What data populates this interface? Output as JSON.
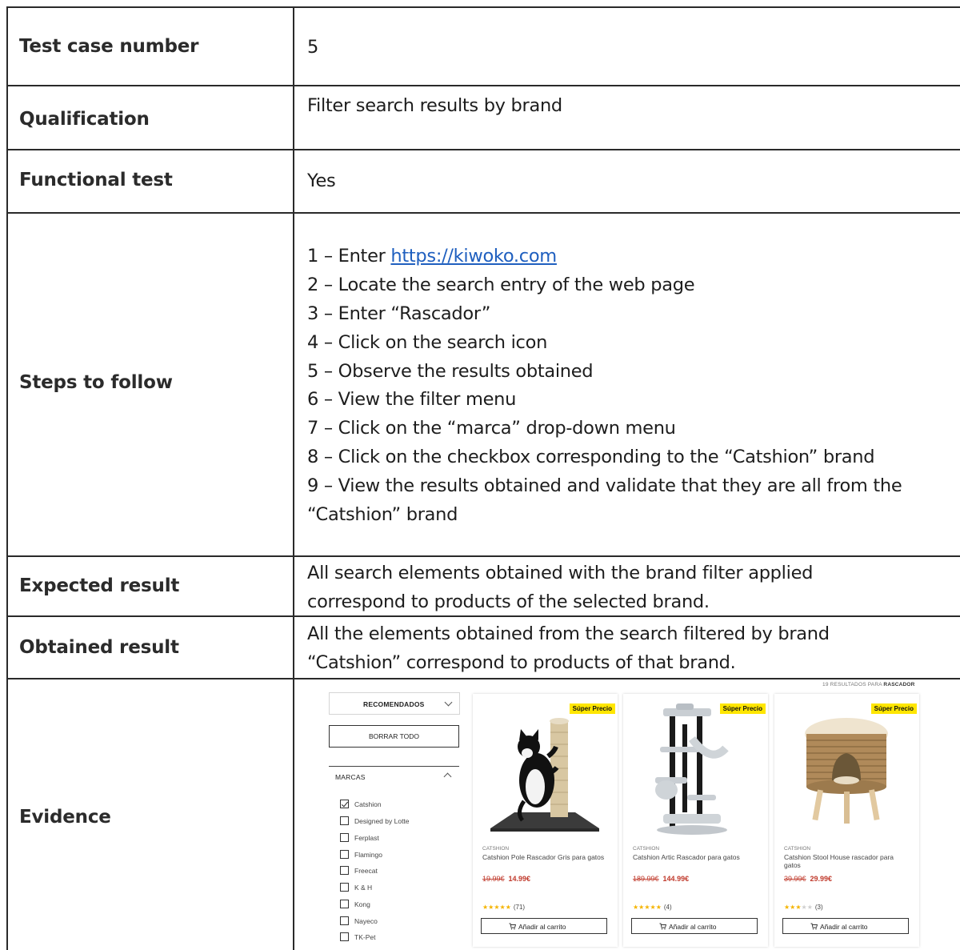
{
  "table": {
    "rows": [
      {
        "label": "Test case number",
        "value": "5"
      },
      {
        "label": "Qualification",
        "value": "Filter search results by brand"
      },
      {
        "label": "Functional test",
        "value": "Yes"
      },
      {
        "label": "Steps to follow"
      },
      {
        "label": "Expected result",
        "lines": [
          "All search elements obtained with the brand filter applied",
          "correspond to products of the selected brand."
        ]
      },
      {
        "label": "Obtained result",
        "lines": [
          "All the elements obtained from the search filtered by brand",
          "“Catshion” correspond to products of that brand."
        ]
      },
      {
        "label": "Evidence"
      }
    ],
    "steps": [
      {
        "prefix": "1 – Enter ",
        "link": "https://kiwoko.com"
      },
      {
        "text": "2 – Locate the search entry of the web page"
      },
      {
        "text": "3 – Enter “Rascador”"
      },
      {
        "text": "4 – Click on the search icon"
      },
      {
        "text": "5 – Observe the results obtained"
      },
      {
        "text": "6 – View the filter menu"
      },
      {
        "text": "7 – Click on the “marca” drop-down menu"
      },
      {
        "text": "8 – Click on the checkbox corresponding to the “Catshion” brand"
      },
      {
        "text": "9 – View the results obtained and validate that they are all from the"
      },
      {
        "text": "“Catshion” brand"
      }
    ]
  },
  "evidence": {
    "results_count": {
      "prefix": "19 RESULTADOS PARA ",
      "term": "RASCADOR"
    },
    "sort_label": "RECOMENDADOS",
    "clear_all": "BORRAR TODO",
    "brands_title": "MARCAS",
    "brands": [
      {
        "name": "Catshion",
        "checked": true
      },
      {
        "name": "Designed by Lotte",
        "checked": false
      },
      {
        "name": "Ferplast",
        "checked": false
      },
      {
        "name": "Flamingo",
        "checked": false
      },
      {
        "name": "Freecat",
        "checked": false
      },
      {
        "name": "K & H",
        "checked": false
      },
      {
        "name": "Kong",
        "checked": false
      },
      {
        "name": "Nayeco",
        "checked": false
      },
      {
        "name": "TK-Pet",
        "checked": false
      }
    ],
    "products": [
      {
        "badge": "Súper Precio",
        "brand": "CATSHION",
        "title": "Catshion Pole Rascador Gris para gatos",
        "old_price": "19.99€",
        "price": "14.99€",
        "stars": 5,
        "reviews": "(71)",
        "cart": "Añadir al carrito",
        "image": "cat-pole-scratcher"
      },
      {
        "badge": "Súper Precio",
        "brand": "CATSHION",
        "title": "Catshion Artic Rascador para gatos",
        "old_price": "189.99€",
        "price": "144.99€",
        "stars": 5,
        "reviews": "(4)",
        "cart": "Añadir al carrito",
        "image": "cat-tree-tower"
      },
      {
        "badge": "Súper Precio",
        "brand": "CATSHION",
        "title": "Catshion Stool House rascador para gatos",
        "old_price": "39.99€",
        "price": "29.99€",
        "stars": 3,
        "reviews": "(3)",
        "cart": "Añadir al carrito",
        "image": "stool-cat-house"
      }
    ],
    "colors": {
      "badge": "#ffe600",
      "price": "#c0392b",
      "star_on": "#f5b400",
      "link": "#1f5fbf"
    }
  }
}
